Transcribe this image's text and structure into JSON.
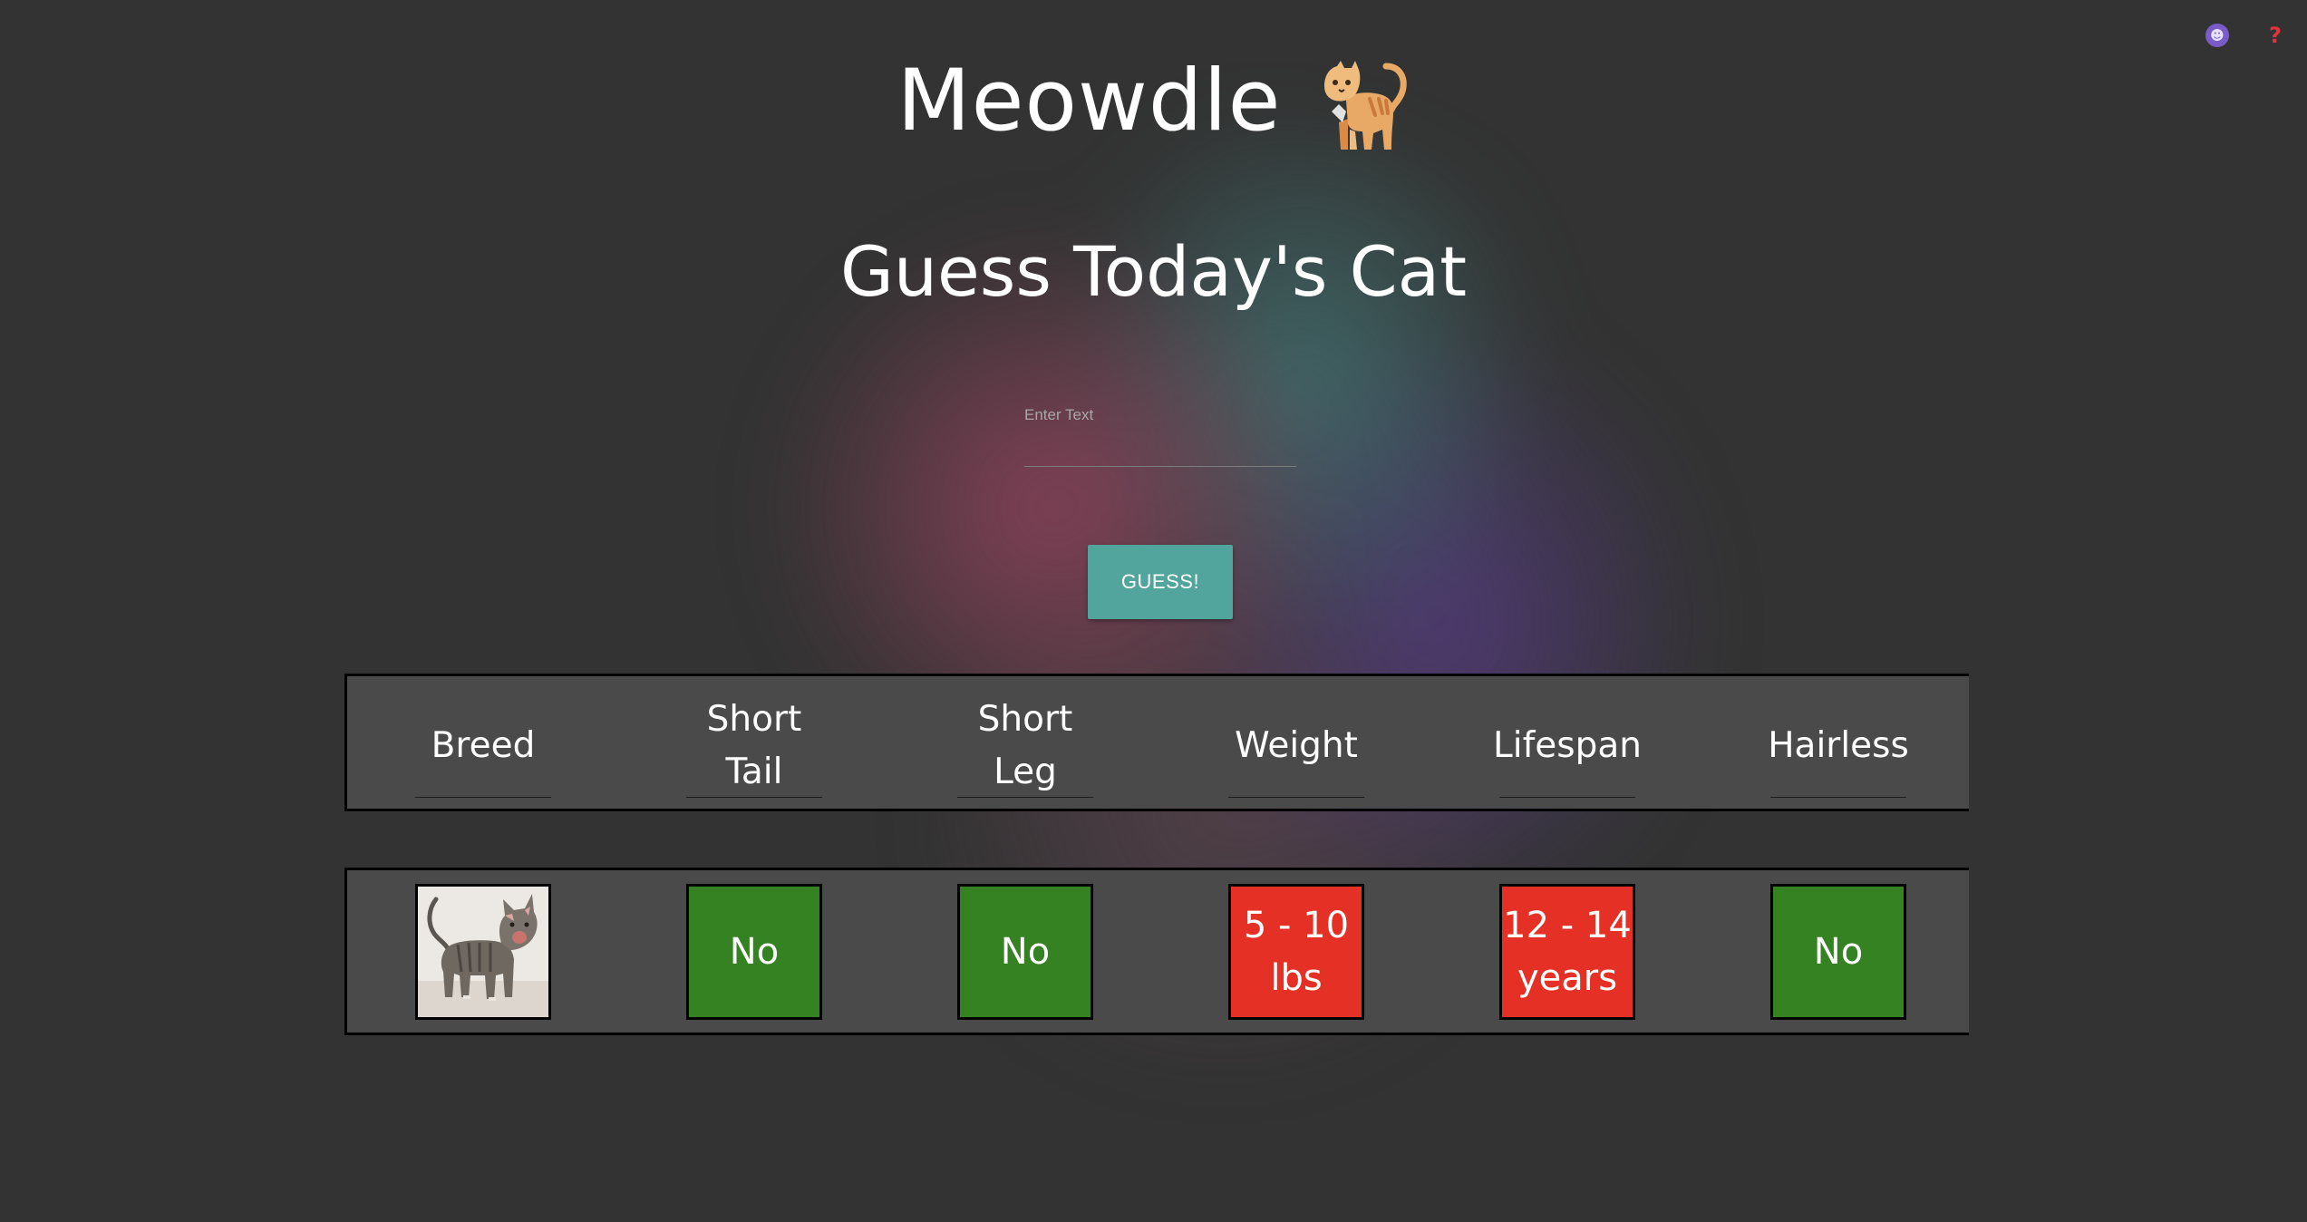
{
  "app": {
    "title": "Meowdle",
    "logo_icon": "cat-icon",
    "subtitle": "Guess Today's Cat"
  },
  "toolbar": {
    "stats_icon": "stats-icon",
    "help_icon": "help-icon",
    "help_glyph": "?"
  },
  "guess_input": {
    "value": "",
    "placeholder": "Enter Text"
  },
  "guess_button": {
    "label": "GUESS!",
    "color": "#52a59c"
  },
  "columns": {
    "breed": "Breed",
    "short_tail_1": "Short",
    "short_tail_2": "Tail",
    "short_leg_1": "Short",
    "short_leg_2": "Leg",
    "weight": "Weight",
    "lifespan": "Lifespan",
    "hairless": "Hairless"
  },
  "guesses": [
    {
      "breed_image": "cat-photo",
      "short_tail": "No",
      "short_leg": "No",
      "weight_1": "5 - 10",
      "weight_2": "lbs",
      "lifespan_1": "12 - 14",
      "lifespan_2": "years",
      "hairless": "No"
    }
  ],
  "colors": {
    "correct": "#348221",
    "incorrect": "#e53125",
    "background": "#333333"
  }
}
